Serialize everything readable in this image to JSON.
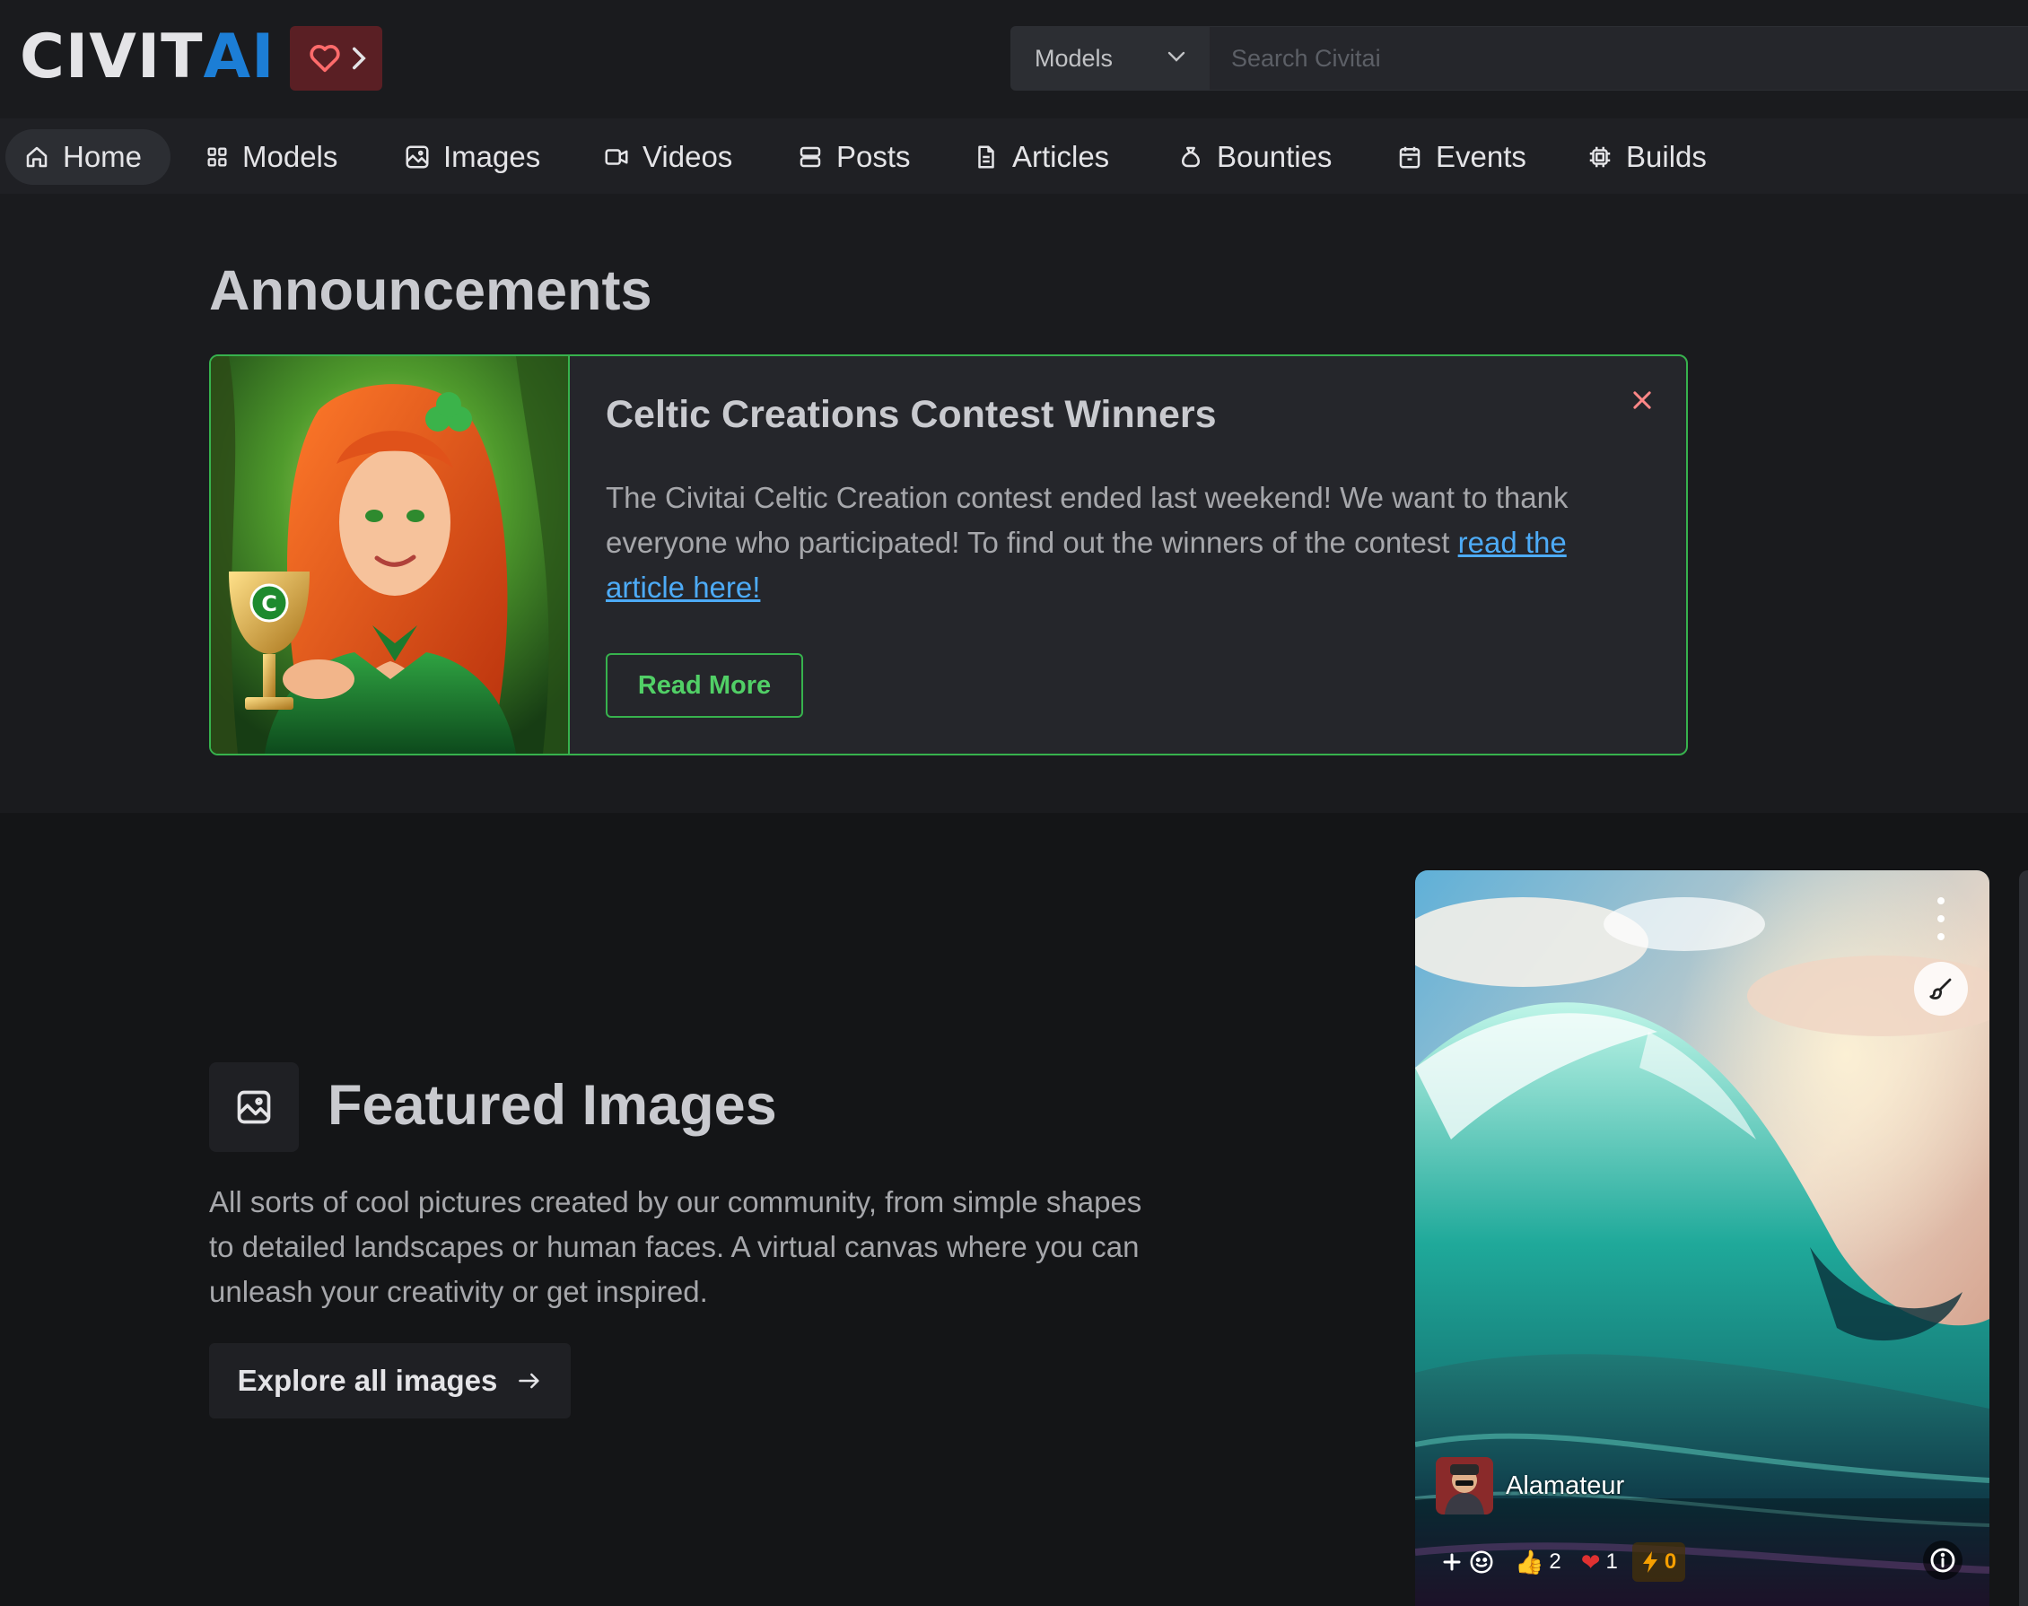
{
  "header": {
    "logo_part1": "CIVIT",
    "logo_part2": "AI",
    "search_type": "Models",
    "search_placeholder": "Search Civitai"
  },
  "nav": [
    {
      "label": "Home",
      "icon": "home-icon",
      "active": true
    },
    {
      "label": "Models",
      "icon": "grid-icon"
    },
    {
      "label": "Images",
      "icon": "photo-icon"
    },
    {
      "label": "Videos",
      "icon": "video-icon"
    },
    {
      "label": "Posts",
      "icon": "posts-icon"
    },
    {
      "label": "Articles",
      "icon": "file-text-icon"
    },
    {
      "label": "Bounties",
      "icon": "moneybag-icon"
    },
    {
      "label": "Events",
      "icon": "calendar-icon"
    },
    {
      "label": "Builds",
      "icon": "cpu-icon"
    }
  ],
  "announcements": {
    "title": "Announcements",
    "card": {
      "heading": "Celtic Creations Contest Winners",
      "body_text": "The Civitai Celtic Creation contest ended last weekend! We want to thank everyone who participated! To find out the winners of the contest",
      "link_text": "read the article here!",
      "button": "Read More"
    }
  },
  "featured": {
    "title": "Featured Images",
    "description": "All sorts of cool pictures created by our community, from simple shapes to detailed landscapes or human faces. A virtual canvas where you can unleash your creativity or get inspired.",
    "button": "Explore all images"
  },
  "image_card": {
    "username": "Alamateur",
    "reactions": {
      "like": "2",
      "heart": "1",
      "buzz": "0"
    }
  },
  "colors": {
    "accent_green": "#37b24d",
    "link_blue": "#4dabf7",
    "logo_blue": "#1c7ed6",
    "buzz_orange": "#f59f00"
  }
}
